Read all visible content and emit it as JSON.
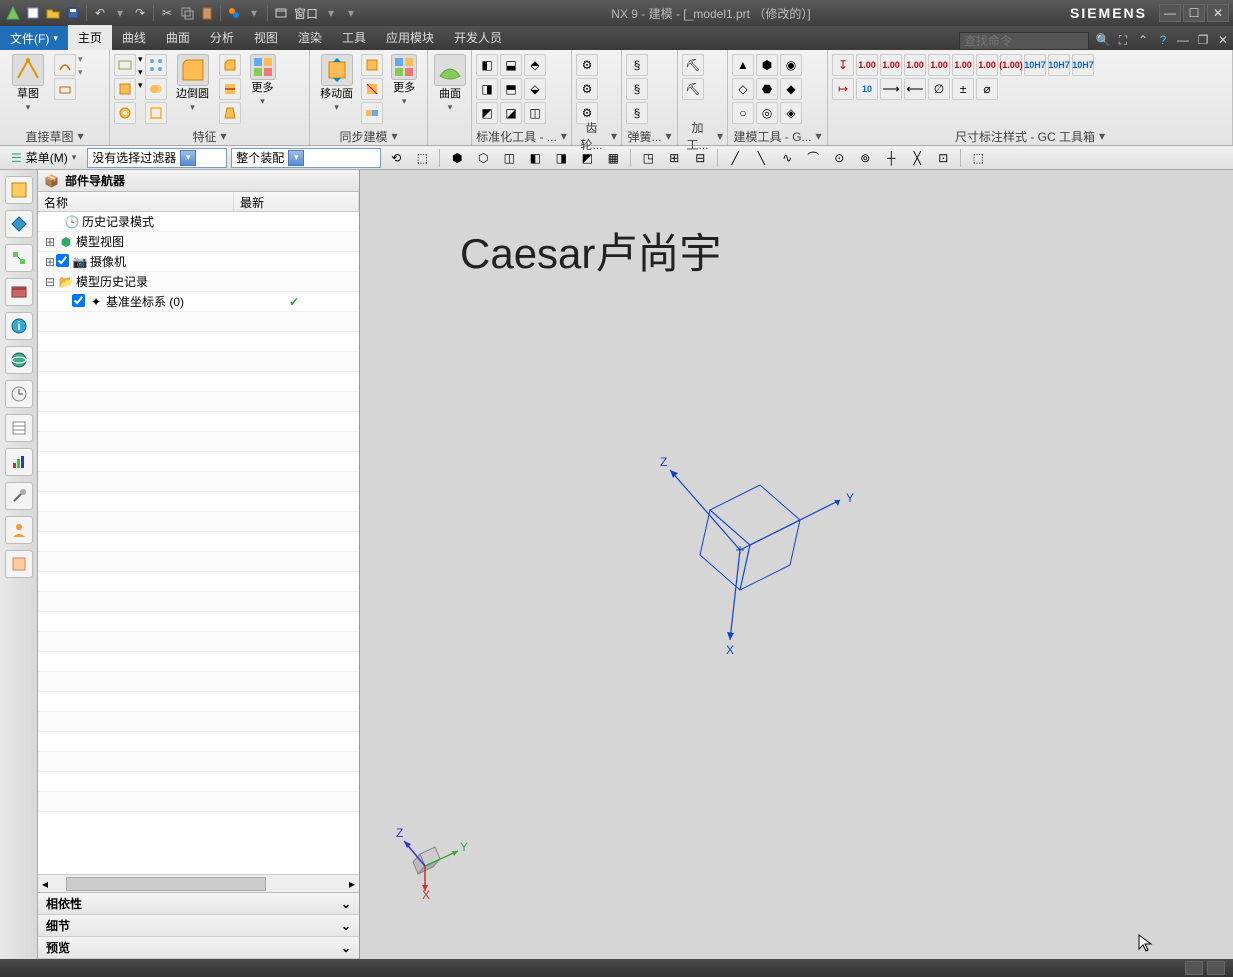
{
  "titlebar": {
    "title": "NX 9 - 建模 - [_model1.prt （修改的）]",
    "brand": "SIEMENS",
    "window_menu": "窗口"
  },
  "tabs": {
    "file": "文件(F)",
    "items": [
      "主页",
      "曲线",
      "曲面",
      "分析",
      "视图",
      "渲染",
      "工具",
      "应用模块",
      "开发人员"
    ],
    "active_index": 0,
    "search_placeholder": "查找命令"
  },
  "ribbon": {
    "g1": {
      "label": "直接草图",
      "sketch": "草图"
    },
    "g2": {
      "label": "特征",
      "chamfer": "边倒圆",
      "more": "更多"
    },
    "g3": {
      "label": "同步建模",
      "move": "移动面",
      "more": "更多"
    },
    "g4": {
      "label": "",
      "surface": "曲面"
    },
    "g5": {
      "label": "标准化工具 - ..."
    },
    "g6": {
      "label": "齿轮..."
    },
    "g7": {
      "label": "弹簧... "
    },
    "g8": {
      "label": "加工..."
    },
    "g9": {
      "label": "建模工具 - G..."
    },
    "g10": {
      "label": "尺寸标注样式 - GC 工具箱"
    },
    "dim_labels": [
      "1.00",
      "1.00",
      "1.00",
      "1.00",
      "1.00",
      "1.00",
      "(1.00)",
      "10H7",
      "10H7",
      "10H7",
      "10"
    ]
  },
  "selbar": {
    "menu": "菜单(M)",
    "filter1": "没有选择过滤器",
    "filter2": "整个装配"
  },
  "nav": {
    "title": "部件导航器",
    "col_name": "名称",
    "col_latest": "最新",
    "rows": {
      "history_mode": "历史记录模式",
      "model_views": "模型视图",
      "cameras": "摄像机",
      "model_history": "模型历史记录",
      "datum_csys": "基准坐标系 (0)"
    },
    "acc": {
      "deps": "相依性",
      "details": "细节",
      "preview": "预览"
    }
  },
  "viewport": {
    "watermark": "Caesar卢尚宇",
    "axes": {
      "x": "X",
      "y": "Y",
      "z": "Z"
    }
  }
}
